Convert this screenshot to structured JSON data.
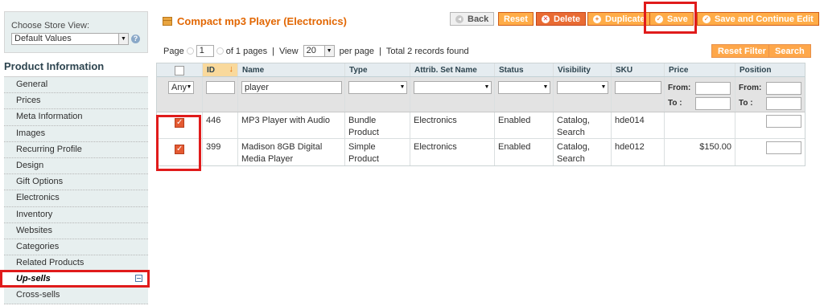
{
  "sidebar": {
    "store_view_label": "Choose Store View:",
    "store_view_value": "Default Values",
    "heading": "Product Information",
    "tabs": [
      {
        "label": "General"
      },
      {
        "label": "Prices"
      },
      {
        "label": "Meta Information"
      },
      {
        "label": "Images"
      },
      {
        "label": "Recurring Profile"
      },
      {
        "label": "Design"
      },
      {
        "label": "Gift Options"
      },
      {
        "label": "Electronics"
      },
      {
        "label": "Inventory"
      },
      {
        "label": "Websites"
      },
      {
        "label": "Categories"
      },
      {
        "label": "Related Products"
      },
      {
        "label": "Up-sells"
      },
      {
        "label": "Cross-sells"
      }
    ],
    "active_tab": "Up-sells"
  },
  "header": {
    "title": "Compact mp3 Player (Electronics)",
    "buttons": {
      "back": "Back",
      "reset": "Reset",
      "delete": "Delete",
      "duplicate": "Duplicate",
      "save": "Save",
      "save_continue": "Save and Continue Edit"
    }
  },
  "pager": {
    "page_label": "Page",
    "page_value": "1",
    "of_pages": "of 1 pages",
    "view_label": "View",
    "view_value": "20",
    "per_page": "per page",
    "total": "Total 2 records found",
    "reset_filter": "Reset Filter",
    "search": "Search"
  },
  "grid": {
    "columns": [
      "ID",
      "Name",
      "Type",
      "Attrib. Set Name",
      "Status",
      "Visibility",
      "SKU",
      "Price",
      "Position"
    ],
    "filters": {
      "select_any": "Any",
      "name": "player",
      "from_label": "From:",
      "to_label": "To :"
    },
    "rows": [
      {
        "checked": true,
        "id": "446",
        "name": "MP3 Player with Audio",
        "type": "Bundle Product",
        "attrib_set": "Electronics",
        "status": "Enabled",
        "visibility": "Catalog, Search",
        "sku": "hde014",
        "price": ""
      },
      {
        "checked": true,
        "id": "399",
        "name": "Madison 8GB Digital Media Player",
        "type": "Simple Product",
        "attrib_set": "Electronics",
        "status": "Enabled",
        "visibility": "Catalog, Search",
        "sku": "hde012",
        "price": "$150.00"
      }
    ]
  },
  "colors": {
    "accent": "#e26703",
    "button": "#ffac47",
    "highlight": "#e01b1b",
    "sidebar_bg": "#e7efef"
  }
}
